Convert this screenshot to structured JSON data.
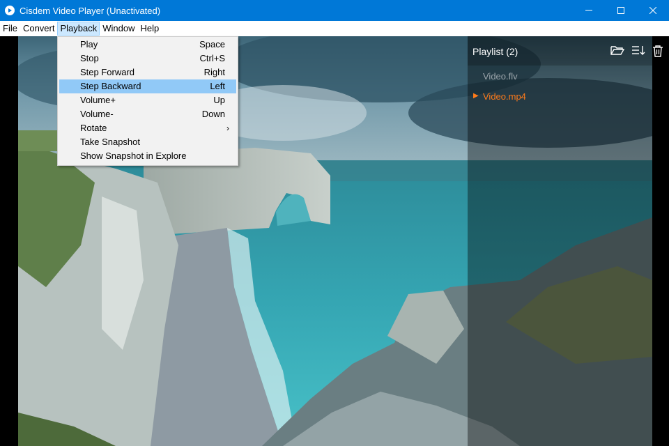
{
  "window": {
    "title": "Cisdem Video Player (Unactivated)",
    "controls": [
      "minimize",
      "maximize",
      "close"
    ]
  },
  "menubar": {
    "items": [
      "File",
      "Convert",
      "Playback",
      "Window",
      "Help"
    ],
    "active": "Playback"
  },
  "playback_menu": {
    "items": [
      {
        "label": "Play",
        "shortcut": "Space"
      },
      {
        "label": "Stop",
        "shortcut": "Ctrl+S"
      },
      {
        "label": "Step Forward",
        "shortcut": "Right"
      },
      {
        "label": "Step Backward",
        "shortcut": "Left",
        "highlighted": true
      },
      {
        "label": "Volume+",
        "shortcut": "Up"
      },
      {
        "label": "Volume-",
        "shortcut": "Down"
      },
      {
        "label": "Rotate",
        "shortcut": "",
        "submenu": true
      },
      {
        "label": "Take Snapshot",
        "shortcut": ""
      },
      {
        "label": "Show Snapshot in Explore",
        "shortcut": ""
      }
    ]
  },
  "playlist": {
    "title": "Playlist (2)",
    "icons": [
      "folder-open-icon",
      "sort-list-icon",
      "trash-icon"
    ],
    "items": [
      {
        "name": "Video.flv",
        "playing": false
      },
      {
        "name": "Video.mp4",
        "playing": true
      }
    ]
  },
  "colors": {
    "titlebar": "#0078d7",
    "menu_highlight": "#91c9f7",
    "playing_item": "#ff7b1a",
    "inactive_item": "#9aa4aa"
  }
}
